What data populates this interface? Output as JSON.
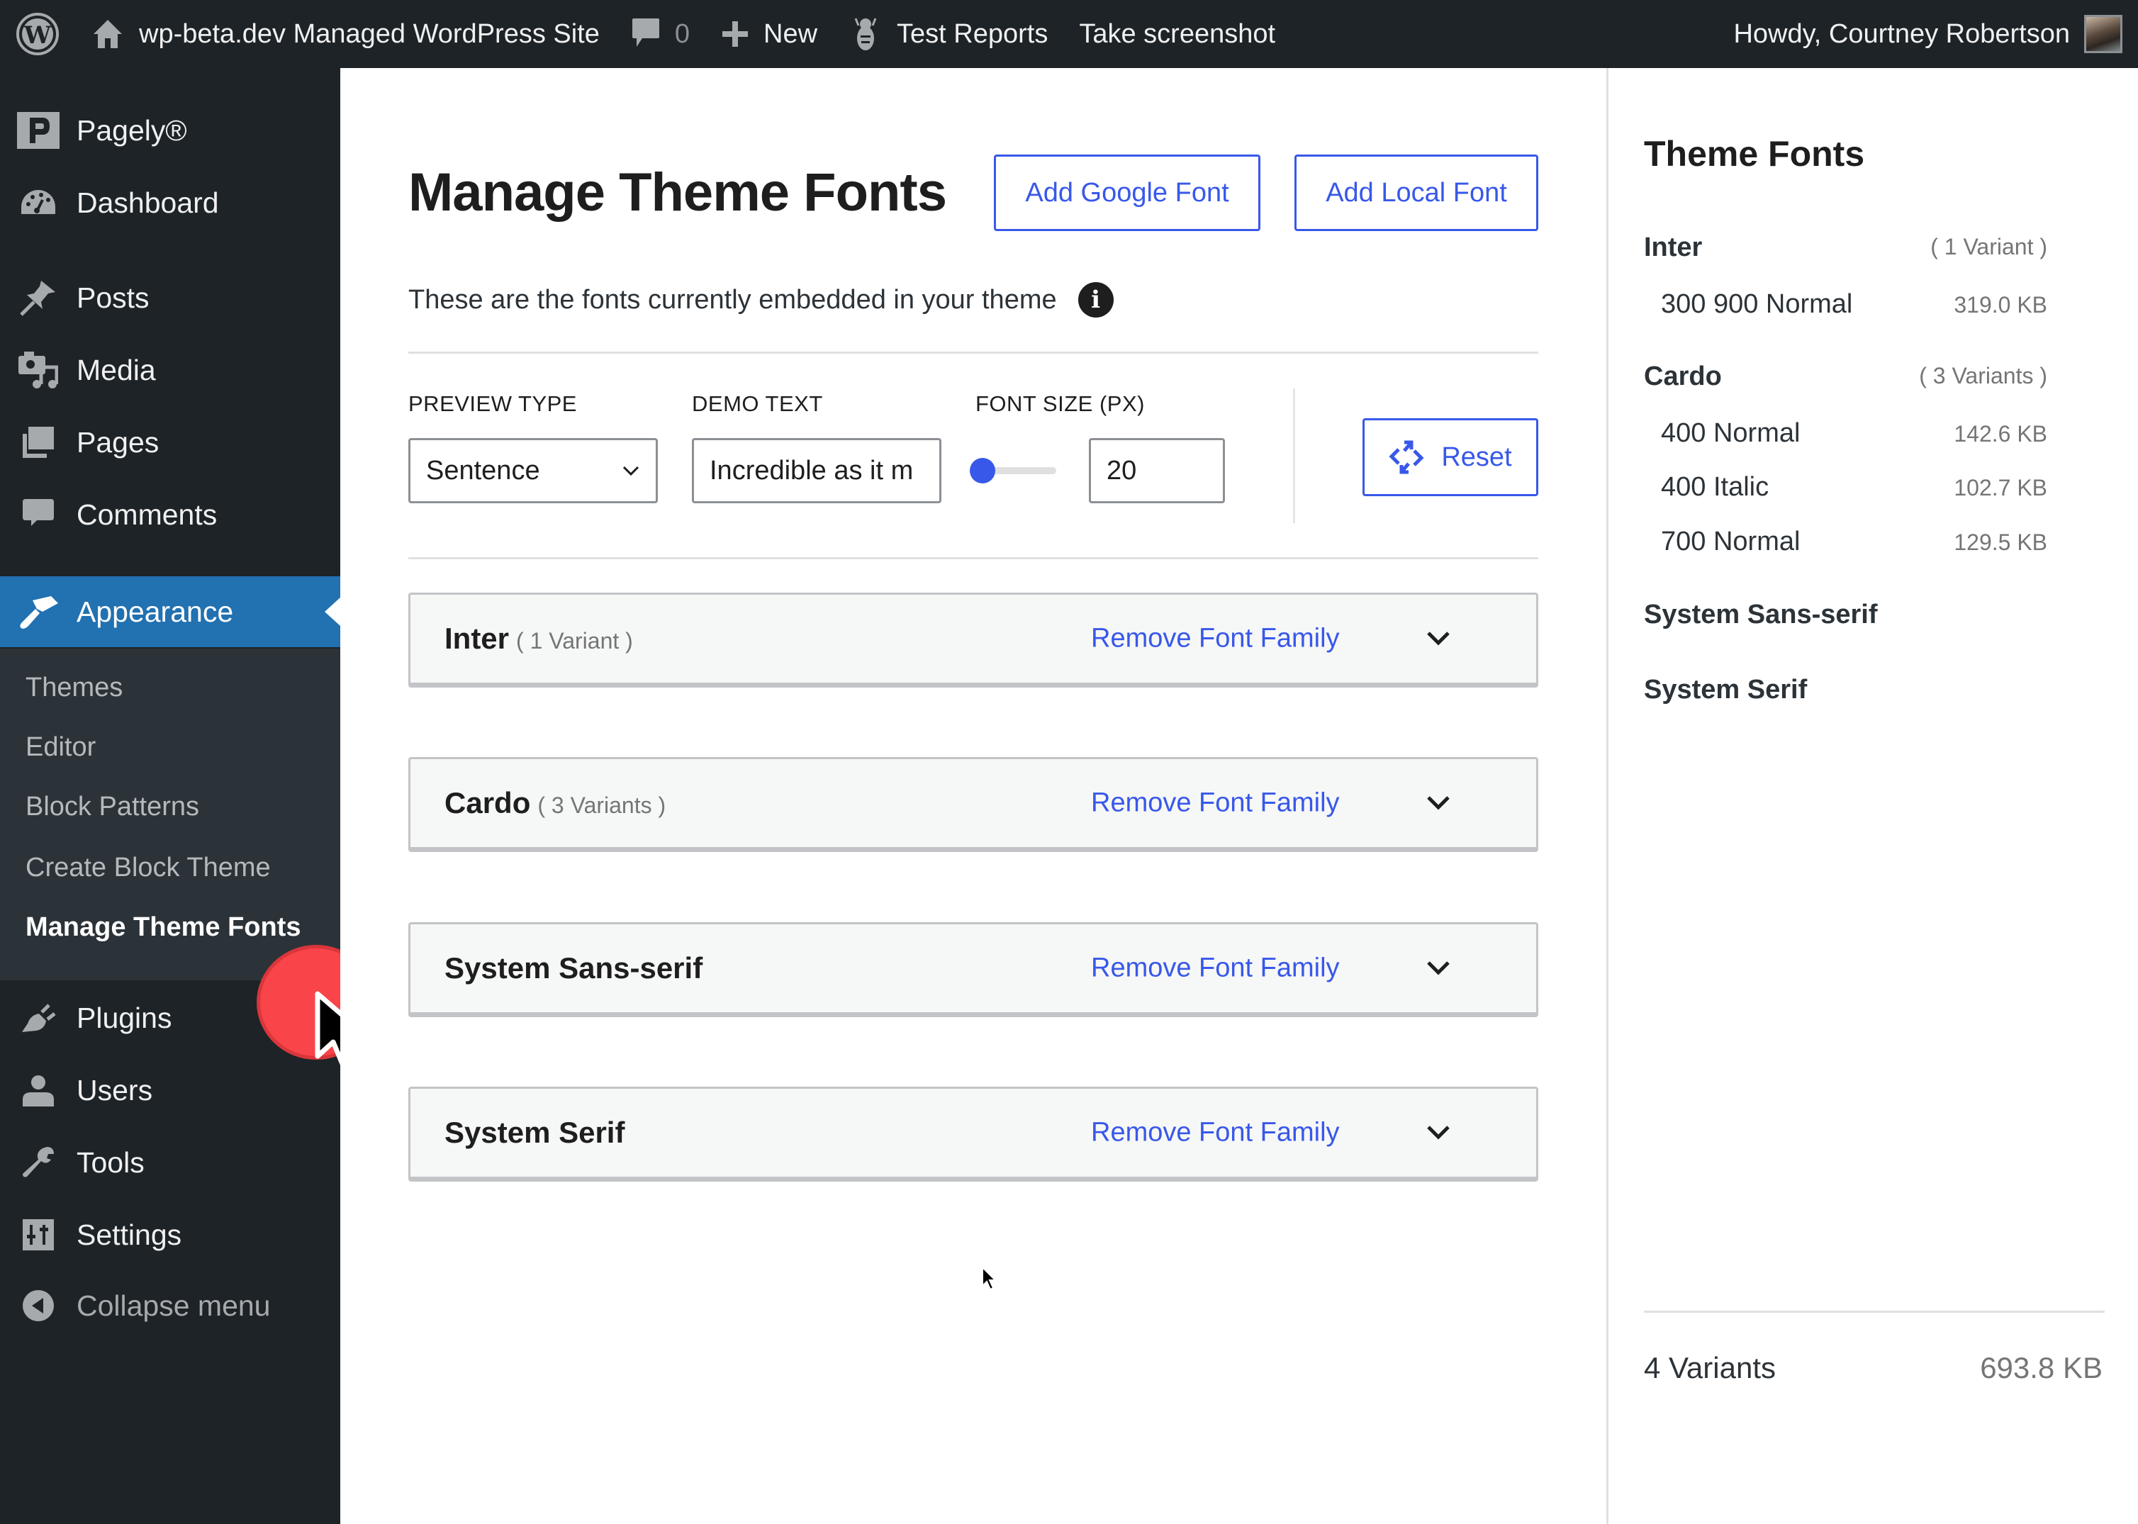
{
  "adminbar": {
    "site_name": "wp-beta.dev Managed WordPress Site",
    "comments_count": "0",
    "new_label": "New",
    "test_reports_label": "Test Reports",
    "screenshot_label": "Take screenshot",
    "greeting": "Howdy, Courtney Robertson"
  },
  "sidebar": {
    "items": [
      {
        "label": "Pagely®",
        "icon": "pagely-logo-icon"
      },
      {
        "label": "Dashboard",
        "icon": "dashboard-gauge-icon"
      },
      {
        "label": "Posts",
        "icon": "pushpin-icon"
      },
      {
        "label": "Media",
        "icon": "media-camera-music-icon"
      },
      {
        "label": "Pages",
        "icon": "pages-icon"
      },
      {
        "label": "Comments",
        "icon": "comment-bubble-icon"
      },
      {
        "label": "Appearance",
        "icon": "paintbrush-icon"
      },
      {
        "label": "Plugins",
        "icon": "plug-icon"
      },
      {
        "label": "Users",
        "icon": "user-icon"
      },
      {
        "label": "Tools",
        "icon": "wrench-icon"
      },
      {
        "label": "Settings",
        "icon": "settings-sliders-icon"
      },
      {
        "label": "Collapse menu",
        "icon": "collapse-arrow-icon"
      }
    ],
    "submenu": [
      "Themes",
      "Editor",
      "Block Patterns",
      "Create Block Theme",
      "Manage Theme Fonts"
    ],
    "active_submenu": "Manage Theme Fonts"
  },
  "main": {
    "title": "Manage Theme Fonts",
    "add_google_font": "Add Google Font",
    "add_local_font": "Add Local Font",
    "subtitle": "These are the fonts currently embedded in your theme",
    "controls": {
      "preview_type_label": "PREVIEW TYPE",
      "preview_type_value": "Sentence",
      "demo_text_label": "DEMO TEXT",
      "demo_text_value": "Incredible as it m",
      "font_size_label": "FONT SIZE (PX)",
      "font_size_value": "20",
      "font_size_slider_fraction": 0.0,
      "reset_label": "Reset"
    },
    "families": [
      {
        "name": "Inter",
        "count": "( 1 Variant )",
        "remove": "Remove Font Family"
      },
      {
        "name": "Cardo",
        "count": "( 3 Variants )",
        "remove": "Remove Font Family"
      },
      {
        "name": "System Sans-serif",
        "count": "",
        "remove": "Remove Font Family"
      },
      {
        "name": "System Serif",
        "count": "",
        "remove": "Remove Font Family"
      }
    ]
  },
  "theme_fonts_panel": {
    "title": "Theme Fonts",
    "families": [
      {
        "name": "Inter",
        "count": "( 1 Variant )",
        "variants": [
          {
            "label": "300 900 Normal",
            "size": "319.0 KB"
          }
        ]
      },
      {
        "name": "Cardo",
        "count": "( 3 Variants )",
        "variants": [
          {
            "label": "400 Normal",
            "size": "142.6 KB"
          },
          {
            "label": "400 Italic",
            "size": "102.7 KB"
          },
          {
            "label": "700 Normal",
            "size": "129.5 KB"
          }
        ]
      },
      {
        "name": "System Sans-serif",
        "count": "",
        "variants": []
      },
      {
        "name": "System Serif",
        "count": "",
        "variants": []
      }
    ],
    "total_variants": "4 Variants",
    "total_size": "693.8 KB"
  },
  "colors": {
    "admin_dark": "#1d2327",
    "submenu_bg": "#2c3338",
    "active_blue": "#2271b1",
    "accent": "#3858e9",
    "click_indicator": "#f94449"
  }
}
